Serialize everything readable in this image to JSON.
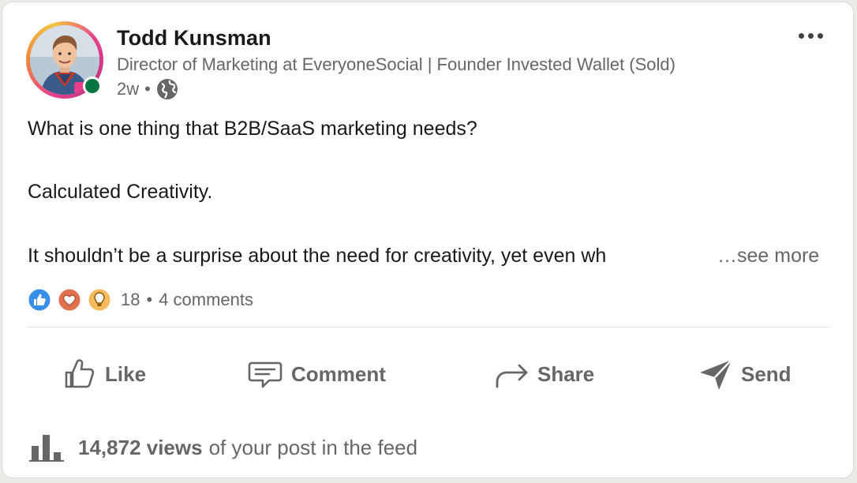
{
  "author": {
    "name": "Todd Kunsman",
    "headline": "Director of Marketing at EveryoneSocial | Founder Invested Wallet (Sold)",
    "time": "2w",
    "separator": "•",
    "visibility_icon": "globe-icon",
    "status": "online",
    "status_color": "#057642"
  },
  "post": {
    "lines": [
      "What is one thing that B2B/SaaS marketing needs?",
      "Calculated Creativity.",
      "It shouldn’t be a surprise about the need for creativity, yet even wh"
    ],
    "see_more": "…see more"
  },
  "social": {
    "reaction_icons": [
      "like-icon",
      "love-icon",
      "insightful-icon"
    ],
    "reaction_count": "18",
    "separator": "•",
    "comments": "4 comments"
  },
  "actions": [
    {
      "label": "Like",
      "icon": "thumbs-up-icon"
    },
    {
      "label": "Comment",
      "icon": "comment-icon"
    },
    {
      "label": "Share",
      "icon": "share-arrow-icon"
    },
    {
      "label": "Send",
      "icon": "send-icon"
    }
  ],
  "analytics": {
    "views_count": "14,872 views",
    "views_suffix": "of your post in the feed",
    "icon": "bar-chart-icon"
  },
  "colors": {
    "text_primary": "#191919",
    "text_secondary": "#666666",
    "like_blue": "#378fe9",
    "love_red": "#df704d",
    "insight_yellow": "#f5bb5c"
  }
}
